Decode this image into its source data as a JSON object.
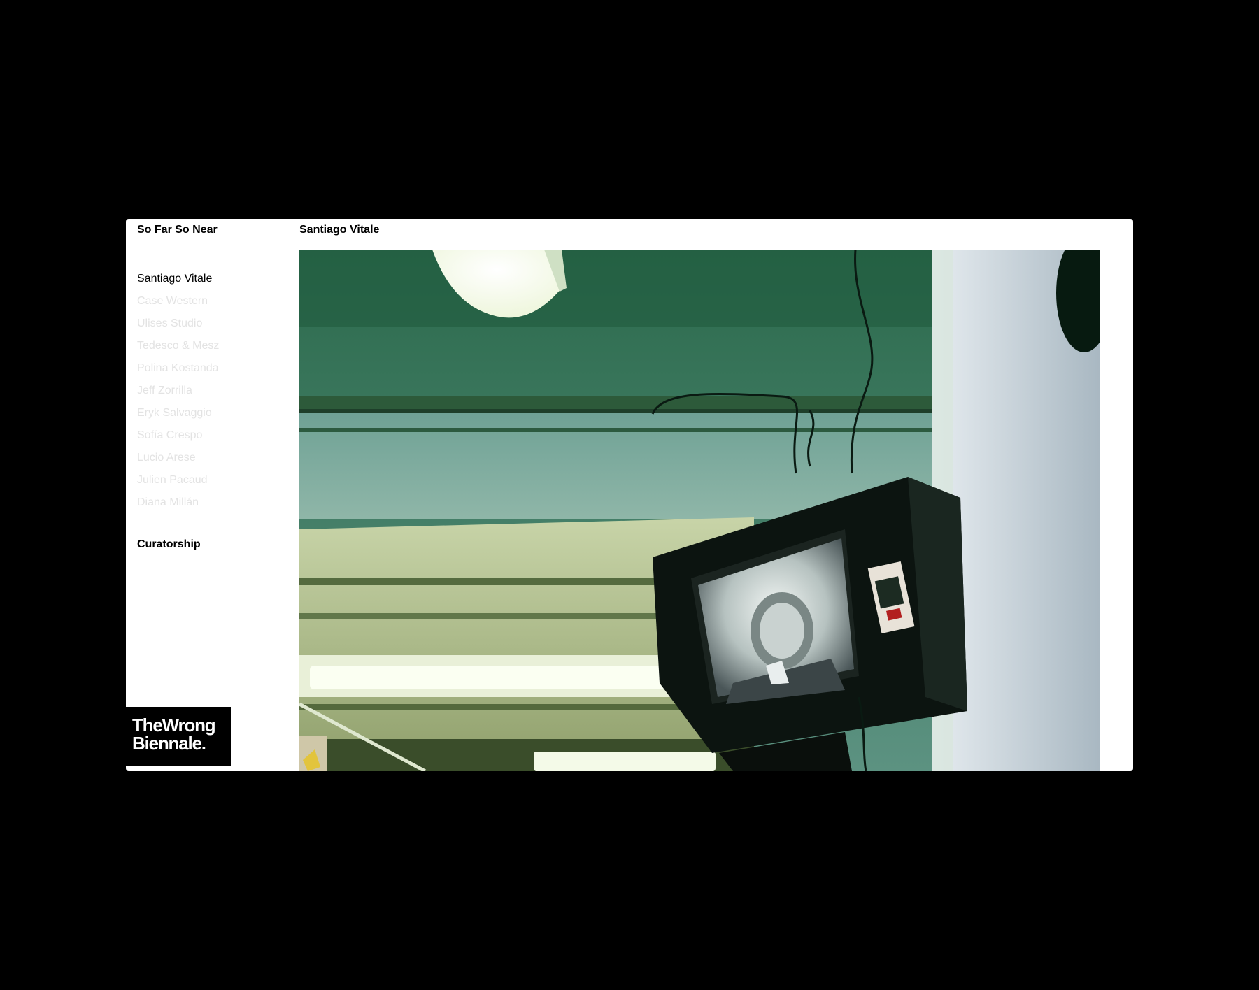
{
  "site": {
    "title": "So Far So Near"
  },
  "artist": {
    "title": "Santiago Vitale"
  },
  "sidebar": {
    "items": [
      {
        "label": "Santiago Vitale"
      },
      {
        "label": "Case Western"
      },
      {
        "label": "Ulises Studio"
      },
      {
        "label": "Tedesco & Mesz"
      },
      {
        "label": "Polina Kostanda"
      },
      {
        "label": "Jeff Zorrilla"
      },
      {
        "label": "Eryk Salvaggio"
      },
      {
        "label": "Sofía Crespo"
      },
      {
        "label": "Lucio Arese"
      },
      {
        "label": "Julien Pacaud"
      },
      {
        "label": "Diana Millán"
      }
    ],
    "active_index": 0,
    "curatorship_label": "Curatorship"
  },
  "logo": {
    "line1": "TheWrong",
    "line2": "Biennale."
  },
  "colors": {
    "page_background": "#000000",
    "panel_background": "#ffffff",
    "active_text": "#000000",
    "inactive_text": "#e3e3e3"
  }
}
